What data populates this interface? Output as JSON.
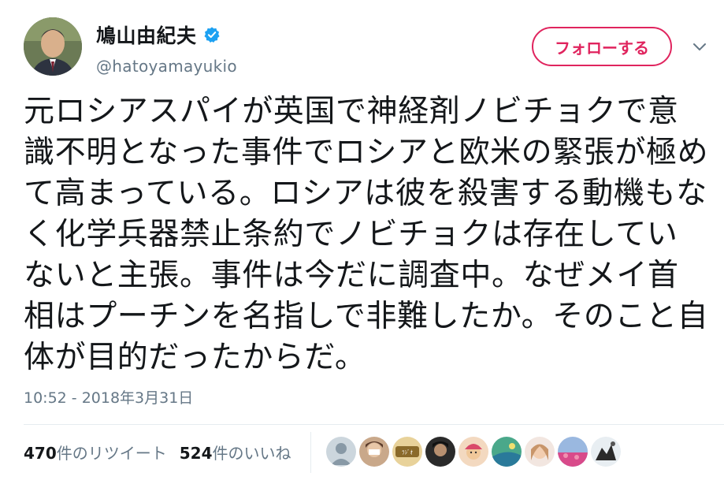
{
  "user": {
    "display_name": "鳩山由紀夫",
    "handle": "@hatoyamayukio",
    "verified": true,
    "avatar_icon": "profile-photo"
  },
  "actions": {
    "follow_label": "フォローする",
    "more_icon": "chevron-down-icon"
  },
  "tweet": {
    "text": "元ロシアスパイが英国で神経剤ノビチョクで意識不明となった事件でロシアと欧米の緊張が極めて高まっている。ロシアは彼を殺害する動機もなく化学兵器禁止条約でノビチョクは存在していないと主張。事件は今だに調査中。なぜメイ首相はプーチンを名指しで非難したか。そのこと自体が目的だったからだ。",
    "timestamp": "10:52 - 2018年3月31日"
  },
  "stats": {
    "retweets_count": "470",
    "retweets_label": "件のリツイート",
    "likes_count": "524",
    "likes_label": "件のいいね"
  },
  "colors": {
    "accent": "#e0245e",
    "verified_blue": "#1da1f2",
    "secondary_text": "#657786",
    "primary_text": "#14171a",
    "divider": "#e6ecf0"
  }
}
